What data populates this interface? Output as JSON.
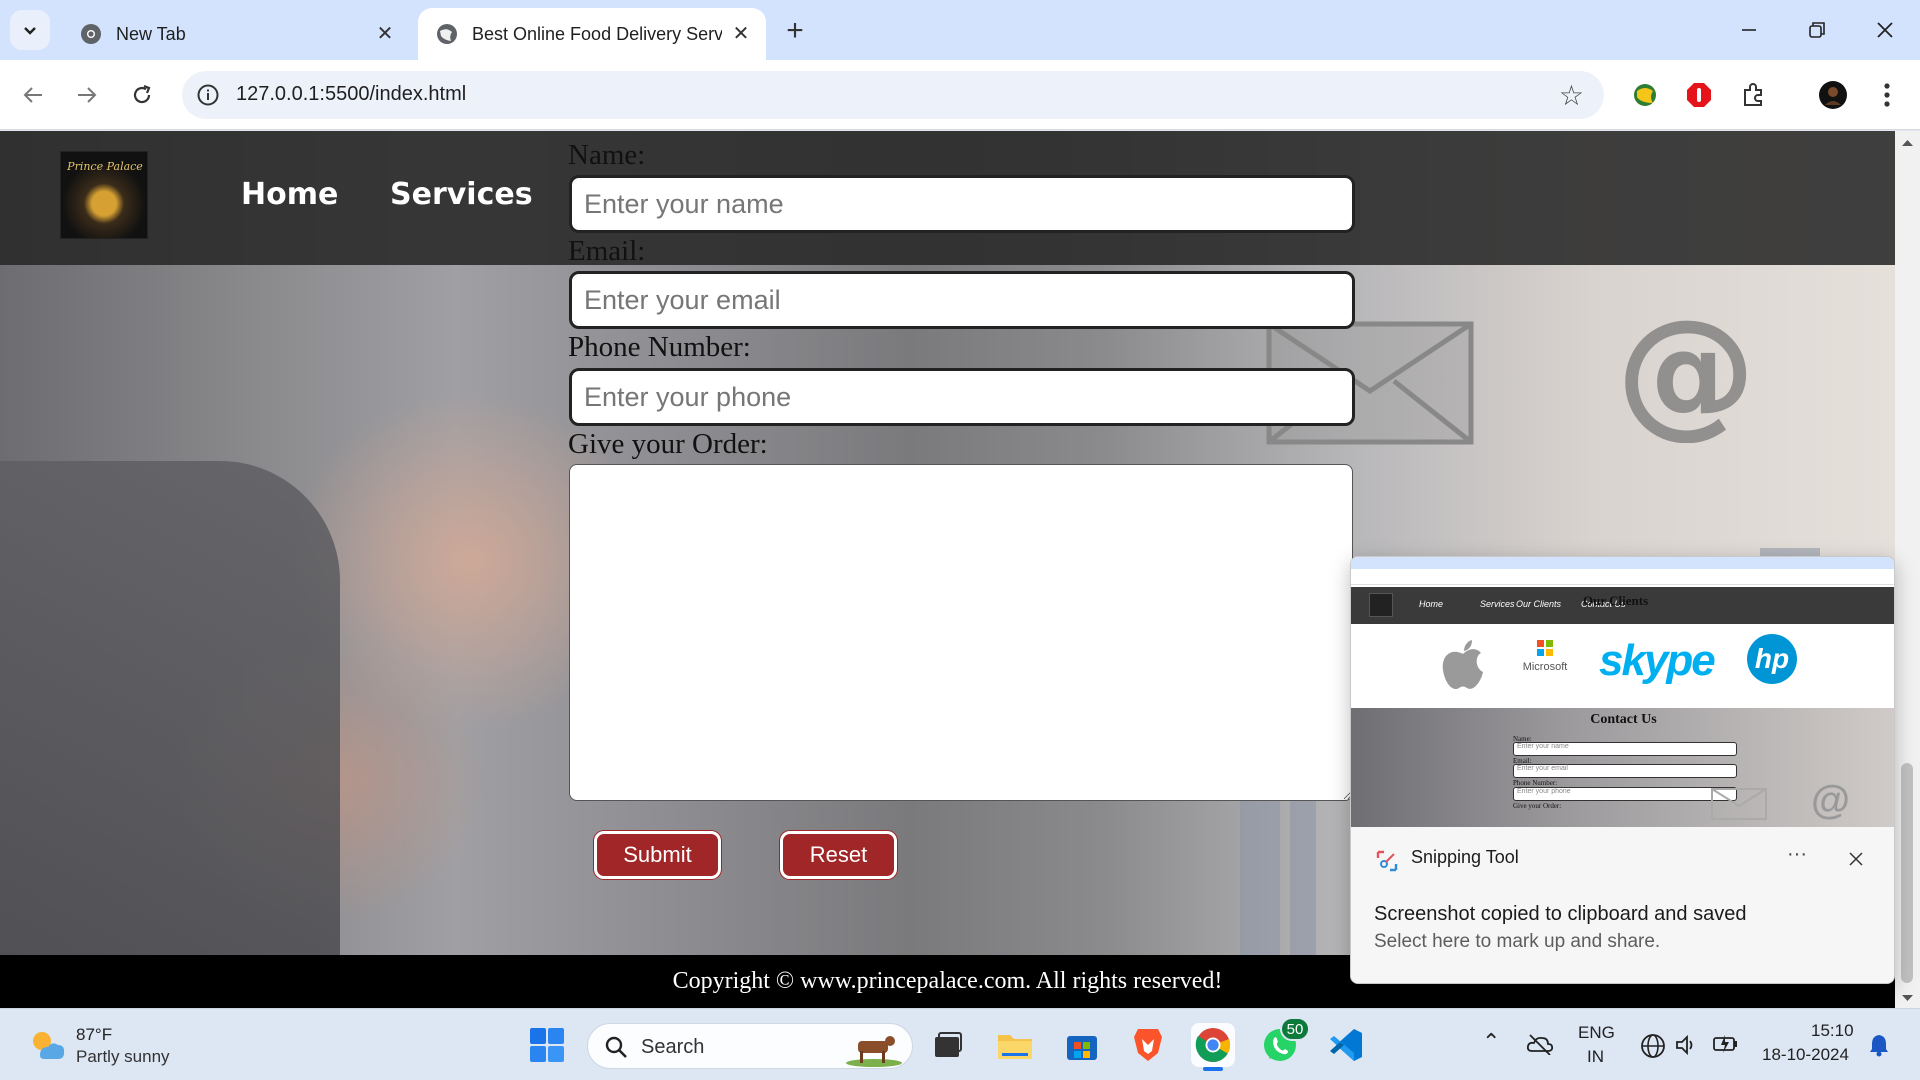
{
  "browser": {
    "tabs": [
      {
        "title": "New Tab",
        "active": false
      },
      {
        "title": "Best Online Food Delivery Servi",
        "active": true
      }
    ],
    "url": "127.0.0.1:5500/index.html"
  },
  "page": {
    "logo_text": "Prince Palace",
    "nav": [
      "Home",
      "Services"
    ],
    "form": {
      "name_label": "Name:",
      "name_placeholder": "Enter your name",
      "email_label": "Email:",
      "email_placeholder": "Enter your email",
      "phone_label": "Phone Number:",
      "phone_placeholder": "Enter your phone",
      "order_label": "Give your Order:",
      "submit": "Submit",
      "reset": "Reset"
    },
    "footer": "Copyright © www.princepalace.com. All rights reserved!"
  },
  "snip_preview": {
    "nav": [
      "Home",
      "Services",
      "Our Clients",
      "Contact Us"
    ],
    "clients_heading": "Our Clients",
    "clients": [
      "Microsoft",
      "skype",
      "hp"
    ],
    "contact_heading": "Contact Us",
    "labels": [
      "Name:",
      "Email:",
      "Phone Number:",
      "Give your Order:"
    ],
    "placeholders": [
      "Enter your name",
      "Enter your email",
      "Enter your phone"
    ]
  },
  "notification": {
    "app": "Snipping Tool",
    "message": "Screenshot copied to clipboard and saved",
    "sub": "Select here to mark up and share."
  },
  "taskbar": {
    "weather_temp": "87°F",
    "weather_desc": "Partly sunny",
    "search": "Search",
    "whatsapp_badge": "50",
    "lang": "ENG",
    "region": "IN",
    "time": "15:10",
    "date": "18-10-2024"
  }
}
